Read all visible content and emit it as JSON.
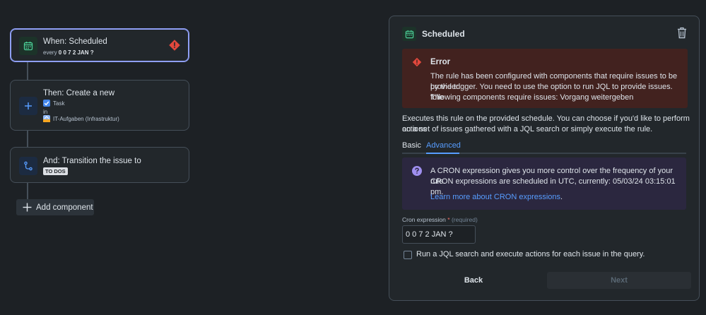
{
  "colors": {
    "background": "#1d2125",
    "node_bg": "#22272b",
    "selected_border": "#8f9ff5",
    "error_bg": "#42221f",
    "error_icon": "#e2483d",
    "info_bg": "#2b273f",
    "info_icon": "#9f8fef",
    "link": "#579dff",
    "trigger_icon": "#4bce97",
    "action_icon": "#579dff"
  },
  "flow": {
    "trigger": {
      "title": "When: Scheduled",
      "sub_prefix": "every",
      "sub_value": "0 0 7 2 JAN ?",
      "icon": "calendar-icon",
      "warning_icon": "error-diamond-icon"
    },
    "action1": {
      "title": "Then: Create a new",
      "issue_type": "Task",
      "in_label": "in",
      "project": "IT-Aufgaben (Infrastruktur)",
      "icon": "plus-icon"
    },
    "action2": {
      "title": "And: Transition the issue to",
      "status": "TO DOS",
      "icon": "transition-icon"
    },
    "add_component": "Add component"
  },
  "panel": {
    "title": "Scheduled",
    "error": {
      "title": "Error",
      "line1": "The rule has been configured with components that require issues to be provided",
      "line2": "by the trigger. You need to use the option to run JQL to provide issues. The",
      "line3": "following components require issues: Vorgang weitergeben"
    },
    "description_line1": "Executes this rule on the provided schedule. You can choose if you'd like to perform actions",
    "description_line2": "on a set of issues gathered with a JQL search or simply execute the rule.",
    "tabs": [
      "Basic",
      "Advanced"
    ],
    "active_tab": "Advanced",
    "info": {
      "line1": "A CRON expression gives you more control over the frequency of your rule.",
      "line2": "CRON expressions are scheduled in UTC, currently: 05/03/24 03:15:01 pm.",
      "link": "Learn more about CRON expressions",
      "link_suffix": "."
    },
    "cron_label": "Cron expression",
    "required_star": "*",
    "required_text": "(required)",
    "cron_value": "0 0 7 2 JAN ?",
    "jql_checkbox_label": "Run a JQL search and execute actions for each issue in the query.",
    "jql_checked": false,
    "back_label": "Back",
    "next_label": "Next"
  }
}
